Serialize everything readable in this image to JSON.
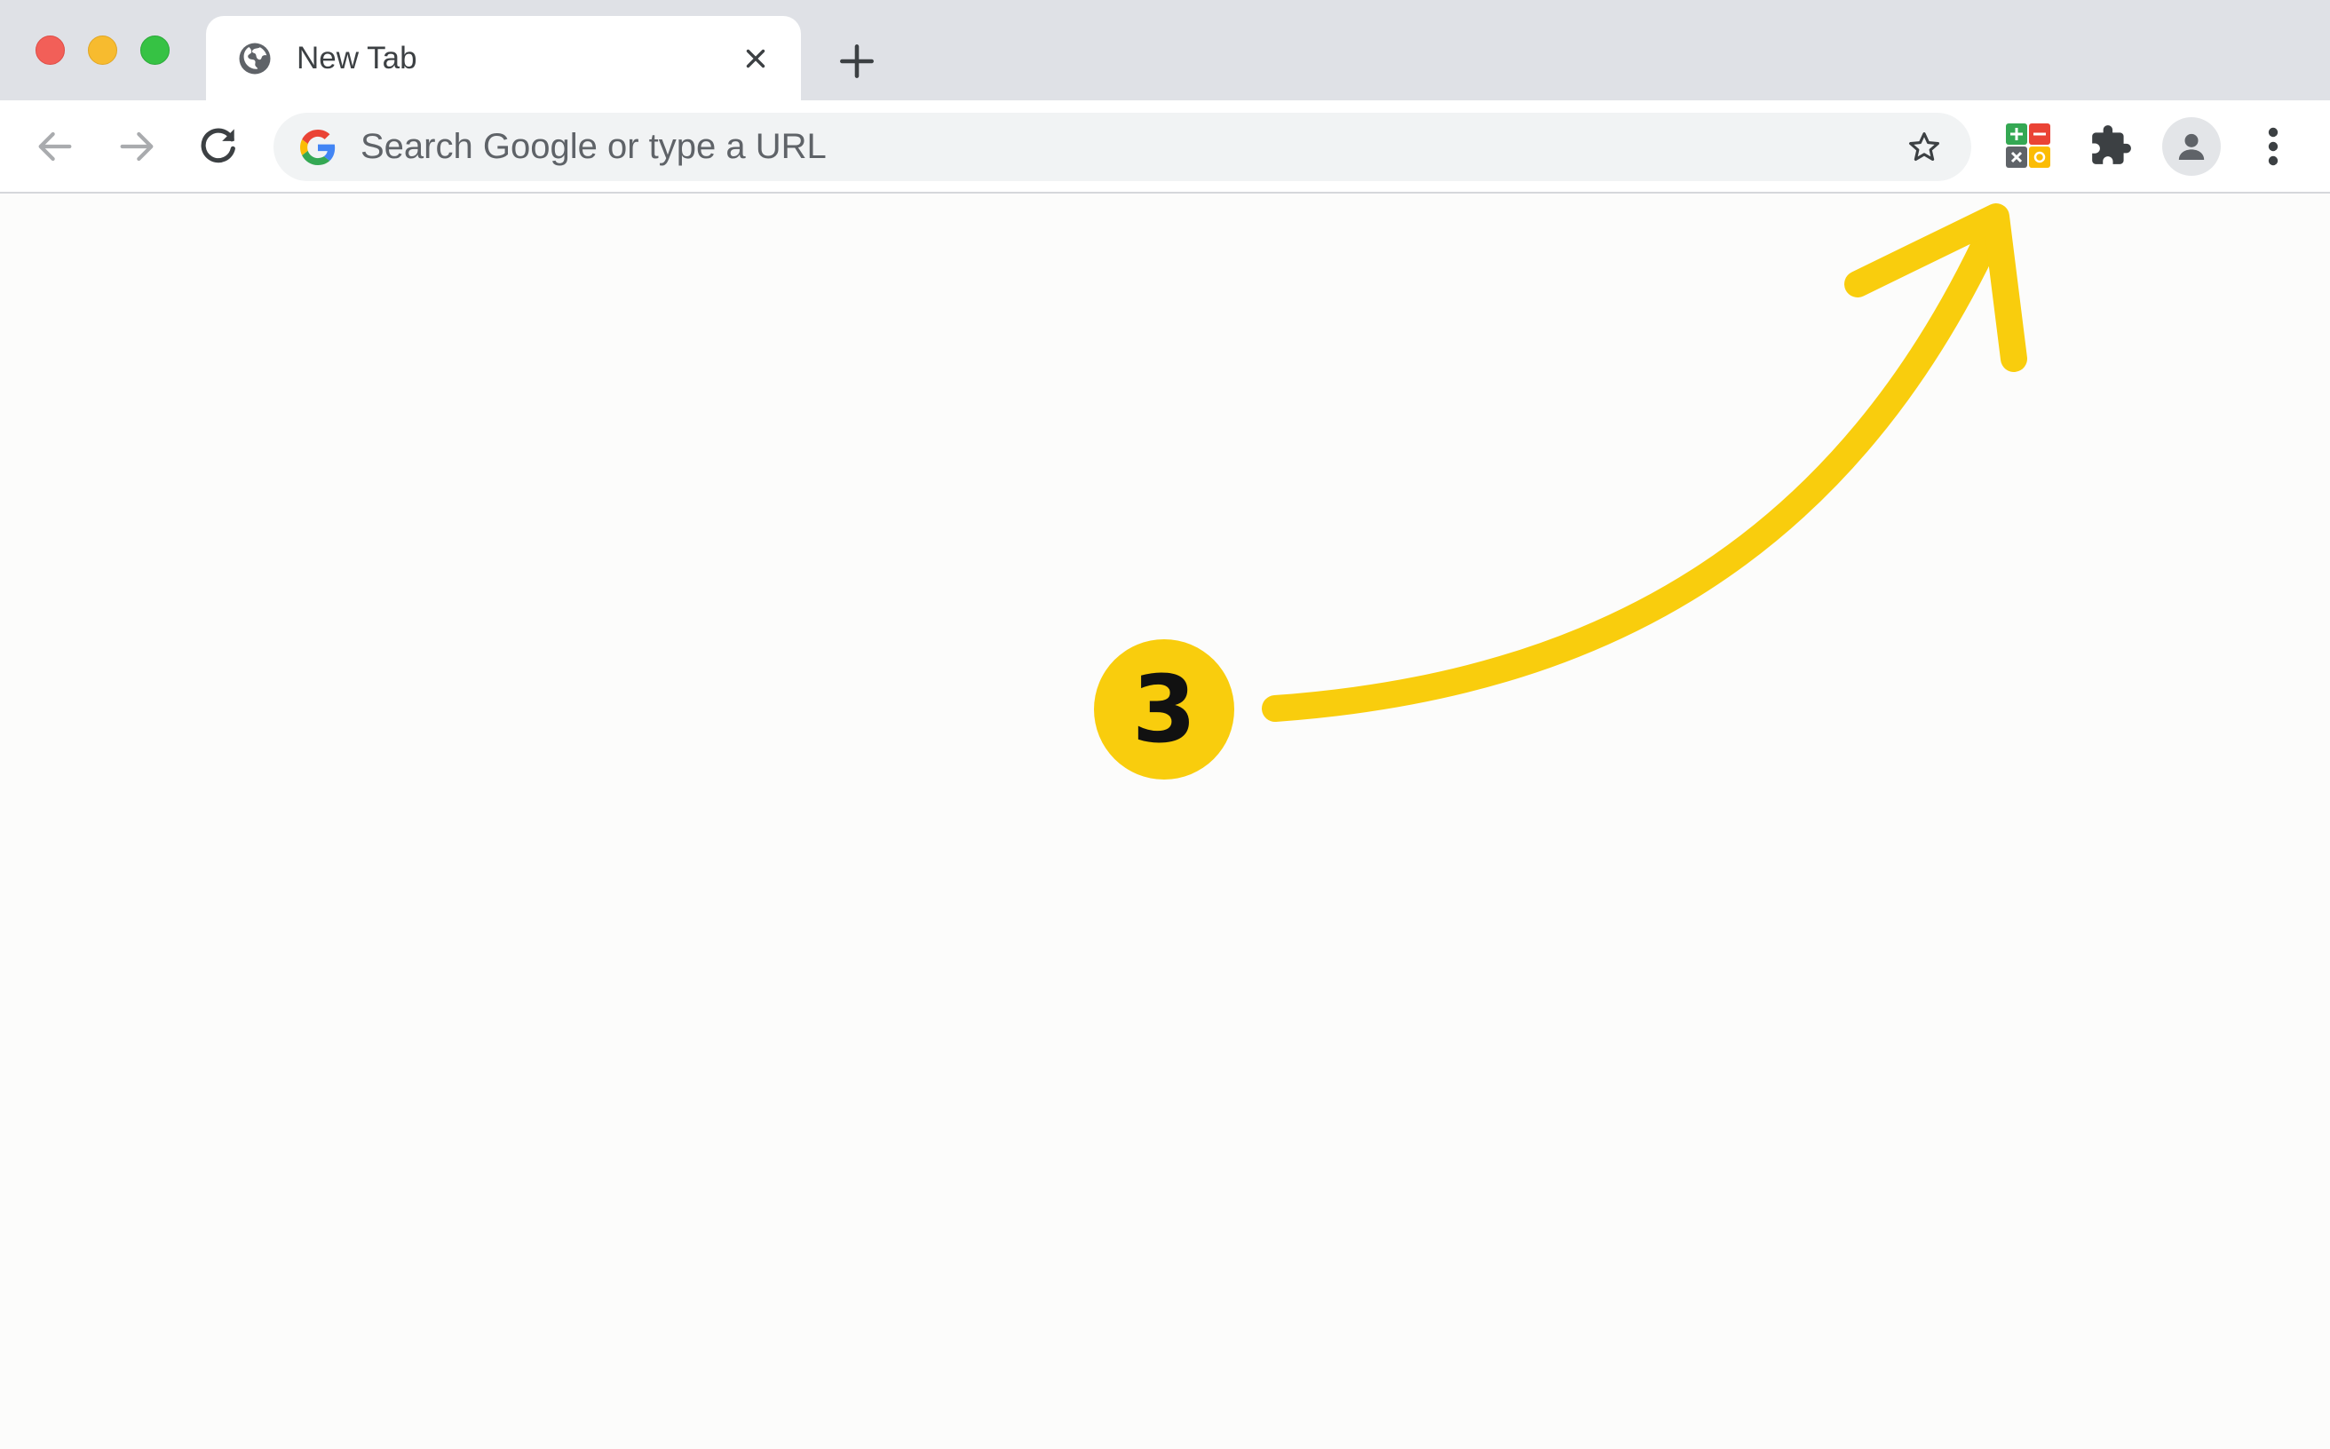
{
  "tab": {
    "title": "New Tab",
    "favicon_icon": "globe-icon",
    "close_icon": "close-icon"
  },
  "tabstrip": {
    "new_tab_icon": "plus-icon"
  },
  "window_controls": [
    "close",
    "minimize",
    "maximize"
  ],
  "toolbar": {
    "back_icon": "arrow-left-icon",
    "forward_icon": "arrow-right-icon",
    "reload_icon": "reload-icon",
    "omnibox": {
      "placeholder": "Search Google or type a URL",
      "logo_icon": "google-g-icon",
      "bookmark_icon": "star-icon"
    },
    "extensions": [
      {
        "name": "calculator-extension",
        "icon": "calculator-icon"
      },
      {
        "name": "extensions-menu",
        "icon": "puzzle-icon"
      }
    ],
    "profile_icon": "person-icon",
    "menu_icon": "kebab-menu-icon"
  },
  "annotation": {
    "step_number": "3",
    "arrow_target": "calculator-extension",
    "color": "#f9cd0d"
  },
  "colors": {
    "tabstrip_bg": "#dfe1e6",
    "toolbar_bg": "#ffffff",
    "omnibox_bg": "#f1f3f4",
    "page_bg": "#fcfcfb",
    "traffic_close": "#f25f58",
    "traffic_minimize": "#f7bb2f",
    "traffic_maximize": "#36c244"
  }
}
